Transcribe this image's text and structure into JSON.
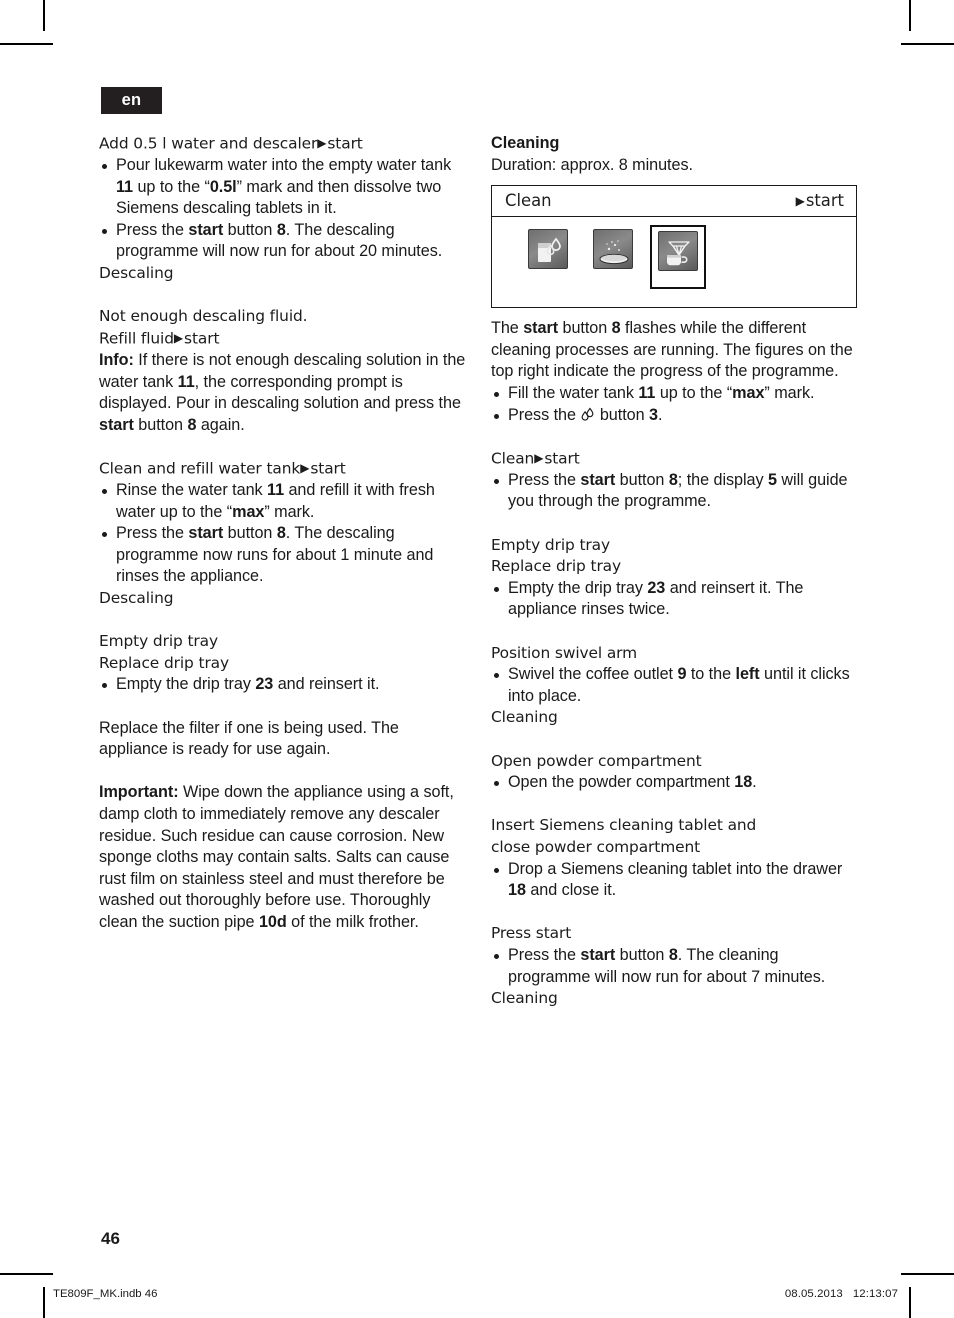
{
  "language_badge": "en",
  "page_number": "46",
  "footer": {
    "file_label": "TE809F_MK.indb   46",
    "date": "08.05.2013",
    "time": "12:13:07"
  },
  "glyphs": {
    "arrow": "▶",
    "water_drop_button": "❑"
  },
  "left_column": {
    "descaling_add_water_prompt": "Add 0.5 l water and descaler",
    "descaling_add_water_prompt_action": "start",
    "bullets_add_water": [
      {
        "parts": [
          {
            "t": "Pour lukewarm water into the empty water tank "
          },
          {
            "t": "11",
            "b": true
          },
          {
            "t": " up to the “"
          },
          {
            "t": "0.5l",
            "b": true
          },
          {
            "t": "” mark and then dissolve two Siemens descaling tablets in it."
          }
        ]
      },
      {
        "parts": [
          {
            "t": "Press the "
          },
          {
            "t": "start",
            "b": true
          },
          {
            "t": " button "
          },
          {
            "t": "8",
            "b": true
          },
          {
            "t": ". The descaling programme will now run for about 20 minutes."
          }
        ]
      }
    ],
    "status_descaling_1": "Descaling",
    "not_enough_fluid_line1": "Not enough descaling fluid.",
    "not_enough_fluid_line2": "Refill fluid",
    "not_enough_fluid_action": "start",
    "info_paragraph": [
      {
        "t": "Info:",
        "b": true
      },
      {
        "t": " If there is not enough descaling solution in the water tank "
      },
      {
        "t": "11",
        "b": true
      },
      {
        "t": ", the corresponding prompt is displayed. Pour in descaling solution and press the "
      },
      {
        "t": "start",
        "b": true
      },
      {
        "t": " button "
      },
      {
        "t": "8",
        "b": true
      },
      {
        "t": " again."
      }
    ],
    "clean_refill_prompt": "Clean and refill water tank",
    "clean_refill_action": "start",
    "bullets_clean_refill": [
      {
        "parts": [
          {
            "t": "Rinse the water tank "
          },
          {
            "t": "11",
            "b": true
          },
          {
            "t": " and refill it with fresh water up to the “"
          },
          {
            "t": "max",
            "b": true
          },
          {
            "t": "” mark."
          }
        ]
      },
      {
        "parts": [
          {
            "t": "Press the "
          },
          {
            "t": "start",
            "b": true
          },
          {
            "t": " button "
          },
          {
            "t": "8",
            "b": true
          },
          {
            "t": ". The descaling programme now runs for about 1 minute and rinses the appliance."
          }
        ]
      }
    ],
    "status_descaling_2": "Descaling",
    "empty_drip_tray_line1": "Empty drip tray",
    "empty_drip_tray_line2": "Replace drip tray",
    "bullets_drip_tray": [
      {
        "parts": [
          {
            "t": "Empty the drip tray "
          },
          {
            "t": "23",
            "b": true
          },
          {
            "t": " and reinsert it."
          }
        ]
      }
    ],
    "filter_paragraph": "Replace the filter if one is being used. The appliance is ready for use again.",
    "important_paragraph": [
      {
        "t": "Important:",
        "b": true
      },
      {
        "t": " Wipe down the appliance using a soft, damp cloth to immediately remove any descaler residue. Such residue can cause corrosion. New sponge cloths may contain salts. Salts can cause rust film on stainless steel and must therefore be washed out thoroughly before use. Thoroughly clean the suction pipe "
      },
      {
        "t": "10d",
        "b": true
      },
      {
        "t": " of the milk frother."
      }
    ]
  },
  "right_column": {
    "heading": "Cleaning",
    "duration": "Duration: approx. 8 minutes.",
    "screen": {
      "title": "Clean",
      "action": "start",
      "tiles": [
        {
          "icon": "water-glass-drops-icon",
          "selected": false
        },
        {
          "icon": "cleaning-tablet-icon",
          "selected": false
        },
        {
          "icon": "sparkling-cup-icon",
          "selected": true
        }
      ]
    },
    "intro_paragraph": [
      {
        "t": "The "
      },
      {
        "t": "start",
        "b": true
      },
      {
        "t": " button "
      },
      {
        "t": "8",
        "b": true
      },
      {
        "t": " flashes while the different cleaning processes are running. The figures on the top right indicate the progress of the programme."
      }
    ],
    "bullets_intro": [
      {
        "parts": [
          {
            "t": "Fill the water tank "
          },
          {
            "t": "11",
            "b": true
          },
          {
            "t": " up to the “"
          },
          {
            "t": "max",
            "b": true
          },
          {
            "t": "” mark."
          }
        ]
      },
      {
        "parts": [
          {
            "t": "Press the "
          },
          {
            "t": "◌",
            "drop": true
          },
          {
            "t": " button "
          },
          {
            "t": "3",
            "b": true
          },
          {
            "t": "."
          }
        ]
      }
    ],
    "clean_prompt": "Clean",
    "clean_action": "start",
    "bullets_clean": [
      {
        "parts": [
          {
            "t": "Press the "
          },
          {
            "t": "start",
            "b": true
          },
          {
            "t": " button "
          },
          {
            "t": "8",
            "b": true
          },
          {
            "t": "; the display "
          },
          {
            "t": "5",
            "b": true
          },
          {
            "t": " will guide you through the programme."
          }
        ]
      }
    ],
    "drip_tray_line1": "Empty drip tray",
    "drip_tray_line2": "Replace drip tray",
    "bullets_drip_tray": [
      {
        "parts": [
          {
            "t": "Empty the drip tray "
          },
          {
            "t": "23",
            "b": true
          },
          {
            "t": " and reinsert it. The appliance rinses twice."
          }
        ]
      }
    ],
    "swivel_prompt": "Position swivel arm",
    "bullets_swivel": [
      {
        "parts": [
          {
            "t": "Swivel the coffee outlet "
          },
          {
            "t": "9",
            "b": true
          },
          {
            "t": " to the "
          },
          {
            "t": "left",
            "b": true
          },
          {
            "t": " until it clicks into place."
          }
        ]
      }
    ],
    "status_cleaning_1": "Cleaning",
    "powder_prompt": "Open powder compartment",
    "bullets_powder": [
      {
        "parts": [
          {
            "t": "Open the powder compartment "
          },
          {
            "t": "18",
            "b": true
          },
          {
            "t": "."
          }
        ]
      }
    ],
    "tablet_prompt_line1": "Insert Siemens cleaning tablet and",
    "tablet_prompt_line2": "close powder compartment",
    "bullets_tablet": [
      {
        "parts": [
          {
            "t": "Drop a Siemens cleaning tablet into the drawer "
          },
          {
            "t": "18",
            "b": true
          },
          {
            "t": " and close it."
          }
        ]
      }
    ],
    "press_start_prompt": "Press start",
    "bullets_press_start": [
      {
        "parts": [
          {
            "t": "Press the "
          },
          {
            "t": "start",
            "b": true
          },
          {
            "t": " button "
          },
          {
            "t": "8",
            "b": true
          },
          {
            "t": ". The cleaning programme will now run for about 7 minutes."
          }
        ]
      }
    ],
    "status_cleaning_2": "Cleaning"
  }
}
